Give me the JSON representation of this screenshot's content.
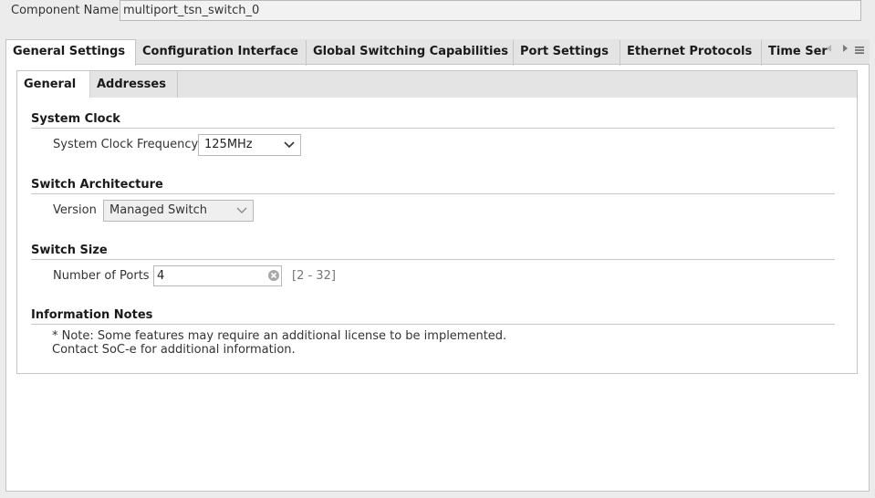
{
  "component": {
    "label": "Component Name",
    "value": "multiport_tsn_switch_0"
  },
  "top_tabs": [
    {
      "label": "General Settings",
      "active": true
    },
    {
      "label": "Configuration Interface",
      "active": false
    },
    {
      "label": "Global Switching Capabilities",
      "active": false
    },
    {
      "label": "Port Settings",
      "active": false
    },
    {
      "label": "Ethernet Protocols",
      "active": false
    },
    {
      "label": "Time Ser",
      "active": false
    }
  ],
  "sub_tabs": [
    {
      "label": "General",
      "active": true
    },
    {
      "label": "Addresses",
      "active": false
    }
  ],
  "sections": {
    "system_clock": {
      "title": "System Clock",
      "freq_label": "System Clock Frequency",
      "freq_value": "125MHz"
    },
    "switch_arch": {
      "title": "Switch Architecture",
      "version_label": "Version",
      "version_value": "Managed Switch"
    },
    "switch_size": {
      "title": "Switch Size",
      "ports_label": "Number of Ports",
      "ports_value": "4",
      "ports_range": "[2 - 32]"
    },
    "info_notes": {
      "title": "Information Notes",
      "line1": "* Note: Some features may require an additional license to be implemented.",
      "line2": "Contact SoC-e for additional information."
    }
  },
  "icons": {
    "tab_scroll_left": "triangle-left-icon",
    "tab_scroll_right": "triangle-right-icon",
    "tab_menu": "menu-icon",
    "dropdown": "chevron-down-icon",
    "clear": "clear-circle-icon"
  }
}
